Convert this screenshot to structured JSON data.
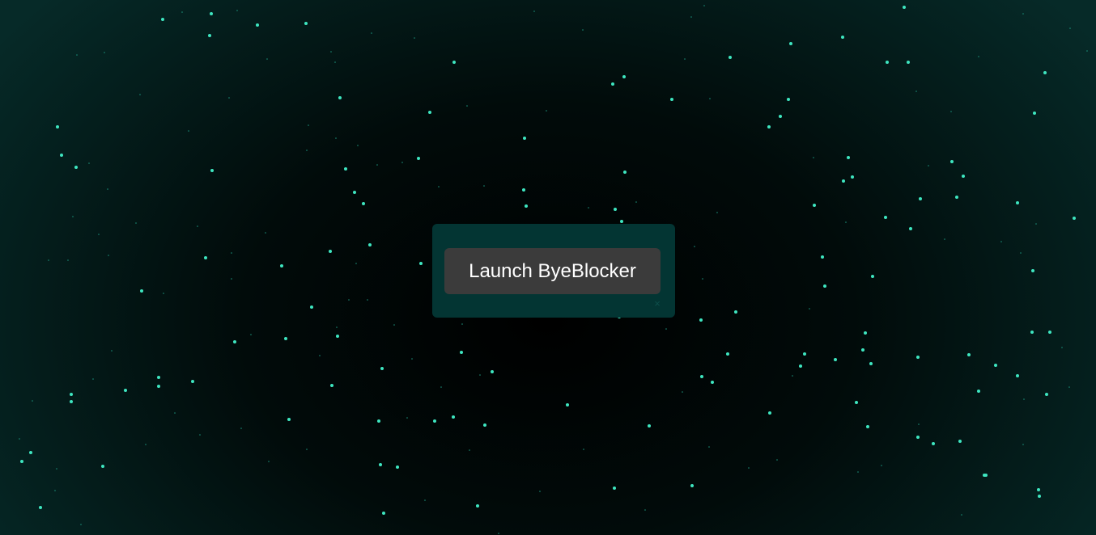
{
  "colors": {
    "star": "#3ee6c0",
    "star_dim": "#1d8f7a",
    "panel_bg": "#033533",
    "button_bg": "#3b3b3b",
    "button_text": "#ffffff"
  },
  "launcher": {
    "button_label": "Launch ByeBlocker",
    "close_label": "×"
  }
}
